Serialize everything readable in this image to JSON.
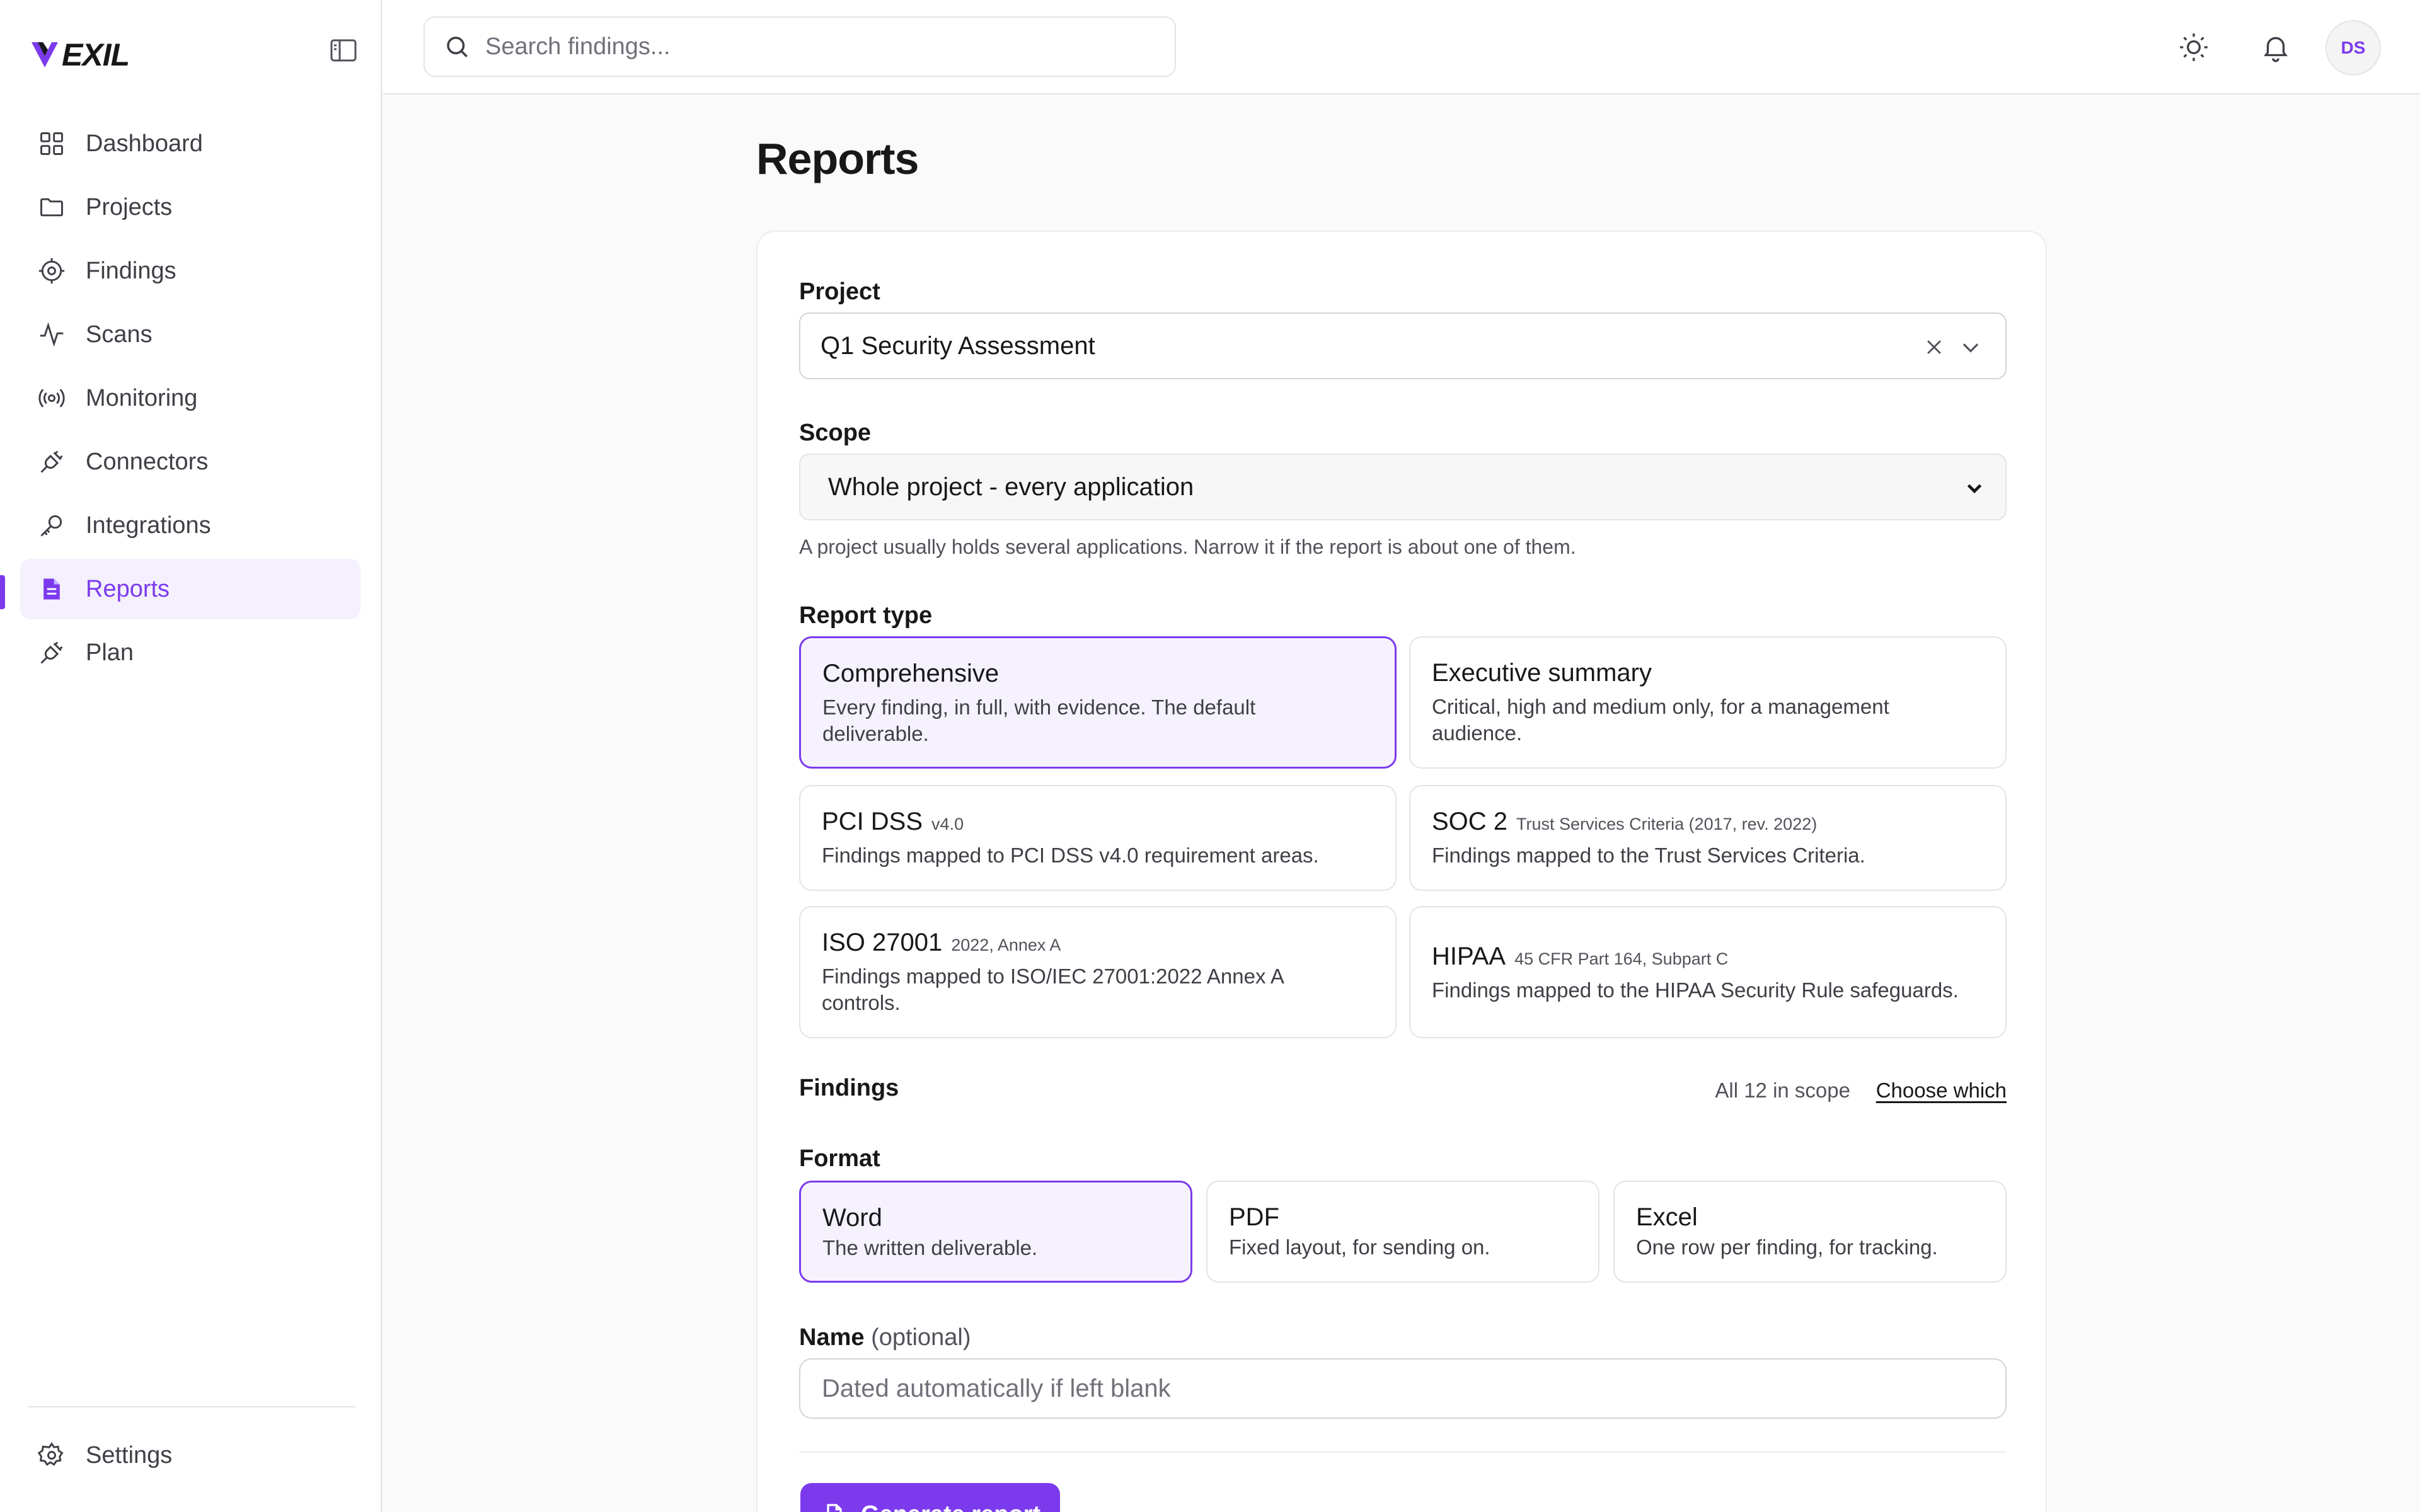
{
  "app": {
    "logo_text": "EXIL"
  },
  "colors": {
    "accent": "#7c3aed",
    "accent_bg": "#f4f0fd",
    "border": "#e4e4e7"
  },
  "sidebar": {
    "items": [
      {
        "label": "Dashboard",
        "icon": "grid-icon"
      },
      {
        "label": "Projects",
        "icon": "folder-icon"
      },
      {
        "label": "Findings",
        "icon": "target-icon"
      },
      {
        "label": "Scans",
        "icon": "activity-icon"
      },
      {
        "label": "Monitoring",
        "icon": "radio-icon"
      },
      {
        "label": "Connectors",
        "icon": "plug-icon"
      },
      {
        "label": "Integrations",
        "icon": "key-icon"
      },
      {
        "label": "Reports",
        "icon": "file-text-icon",
        "active": true
      },
      {
        "label": "Plan",
        "icon": "plug-icon"
      }
    ],
    "settings_label": "Settings"
  },
  "topbar": {
    "search_placeholder": "Search findings...",
    "avatar_initials": "DS"
  },
  "page": {
    "title": "Reports"
  },
  "form": {
    "project": {
      "label": "Project",
      "value": "Q1 Security Assessment"
    },
    "scope": {
      "label": "Scope",
      "value": "Whole project - every application",
      "hint": "A project usually holds several applications. Narrow it if the report is about one of them."
    },
    "report_type": {
      "label": "Report type",
      "options": [
        {
          "title": "Comprehensive",
          "sub": "",
          "desc": "Every finding, in full, with evidence. The default deliverable.",
          "selected": true
        },
        {
          "title": "Executive summary",
          "sub": "",
          "desc": "Critical, high and medium only, for a management audience."
        },
        {
          "title": "PCI DSS",
          "sub": "v4.0",
          "desc": "Findings mapped to PCI DSS v4.0 requirement areas."
        },
        {
          "title": "SOC 2",
          "sub": "Trust Services Criteria (2017, rev. 2022)",
          "desc": "Findings mapped to the Trust Services Criteria."
        },
        {
          "title": "ISO 27001",
          "sub": "2022, Annex A",
          "desc": "Findings mapped to ISO/IEC 27001:2022 Annex A controls."
        },
        {
          "title": "HIPAA",
          "sub": "45 CFR Part 164, Subpart C",
          "desc": "Findings mapped to the HIPAA Security Rule safeguards."
        }
      ]
    },
    "findings": {
      "label": "Findings",
      "scope_text": "All 12 in scope",
      "choose_link": "Choose which"
    },
    "format": {
      "label": "Format",
      "options": [
        {
          "title": "Word",
          "desc": "The written deliverable.",
          "selected": true
        },
        {
          "title": "PDF",
          "desc": "Fixed layout, for sending on."
        },
        {
          "title": "Excel",
          "desc": "One row per finding, for tracking."
        }
      ]
    },
    "name": {
      "label": "Name",
      "optional": "(optional)",
      "placeholder": "Dated automatically if left blank"
    },
    "generate_label": "Generate report"
  }
}
